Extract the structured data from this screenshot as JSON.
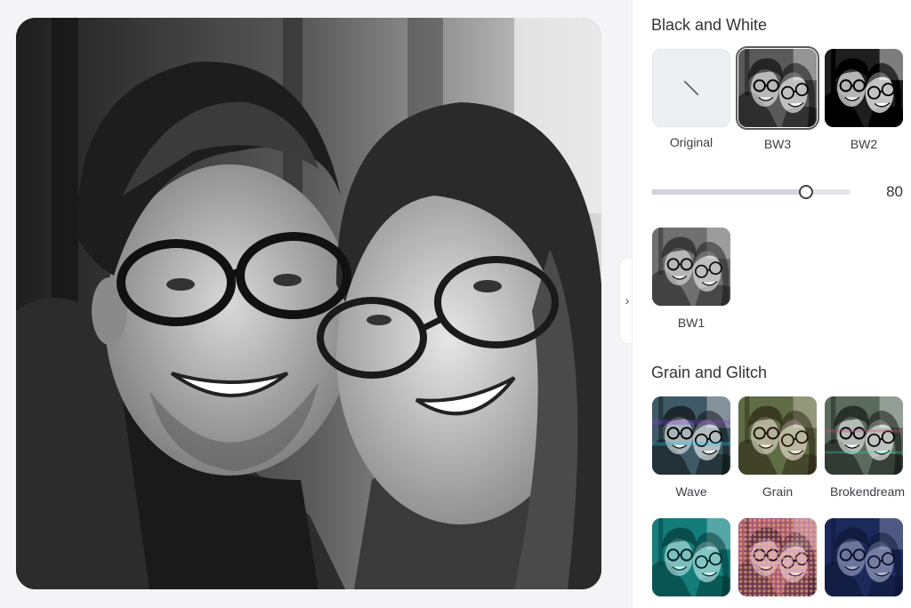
{
  "black_and_white": {
    "title": "Black and White",
    "filters": [
      {
        "label": "Original",
        "selected": false
      },
      {
        "label": "BW3",
        "selected": true
      },
      {
        "label": "BW2",
        "selected": false
      },
      {
        "label": "BW1",
        "selected": false
      }
    ],
    "intensity": {
      "value": "80",
      "level": 80,
      "max": 100
    }
  },
  "grain_and_glitch": {
    "title": "Grain and Glitch",
    "filters": [
      {
        "label": "Wave"
      },
      {
        "label": "Grain"
      },
      {
        "label": "Brokendream"
      },
      {
        "label": ""
      },
      {
        "label": ""
      },
      {
        "label": ""
      }
    ]
  },
  "colors": {
    "accent": "#2f5fe0",
    "panel_bg": "#ffffff",
    "canvas_bg": "#f4f4f6"
  },
  "icons": {
    "collapse": "chevron-right-icon",
    "original": "slash-icon"
  }
}
